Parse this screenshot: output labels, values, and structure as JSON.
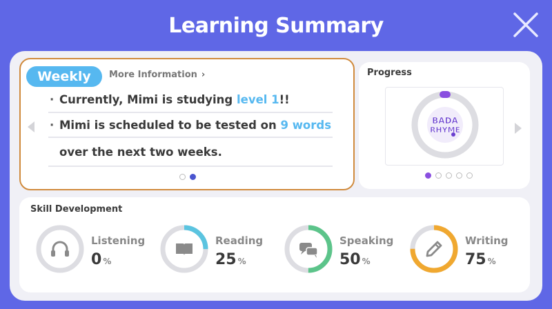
{
  "window": {
    "title": "Learning Summary"
  },
  "weekly": {
    "tag": "Weekly",
    "more_info": "More Information",
    "line1": {
      "prefix": "Currently, Mimi is studying ",
      "highlight": "level 1",
      "suffix": "!!"
    },
    "line2": {
      "prefix": "Mimi is scheduled to be tested on ",
      "highlight": "9 words"
    },
    "line3": "over the next two weeks.",
    "page_count": 2,
    "active_page": 2
  },
  "progress": {
    "label": "Progress",
    "logo_text_top": "BADA",
    "logo_text_bottom": "RHYME",
    "page_count": 5,
    "active_page": 1
  },
  "skills": {
    "label": "Skill Development",
    "items": [
      {
        "name": "Listening",
        "value": "0",
        "unit": "%",
        "percent": 0,
        "color": "#cccccc",
        "icon": "headphones-icon"
      },
      {
        "name": "Reading",
        "value": "25",
        "unit": "%",
        "percent": 25,
        "color": "#5bc4e0",
        "icon": "book-icon"
      },
      {
        "name": "Speaking",
        "value": "50",
        "unit": "%",
        "percent": 50,
        "color": "#5cc48a",
        "icon": "speech-bubbles-icon"
      },
      {
        "name": "Writing",
        "value": "75",
        "unit": "%",
        "percent": 75,
        "color": "#f0a830",
        "icon": "pencil-icon"
      }
    ]
  },
  "colors": {
    "background": "#5f67e6",
    "accent_blue": "#56b8f0",
    "highlight_border": "#d08a3c"
  }
}
